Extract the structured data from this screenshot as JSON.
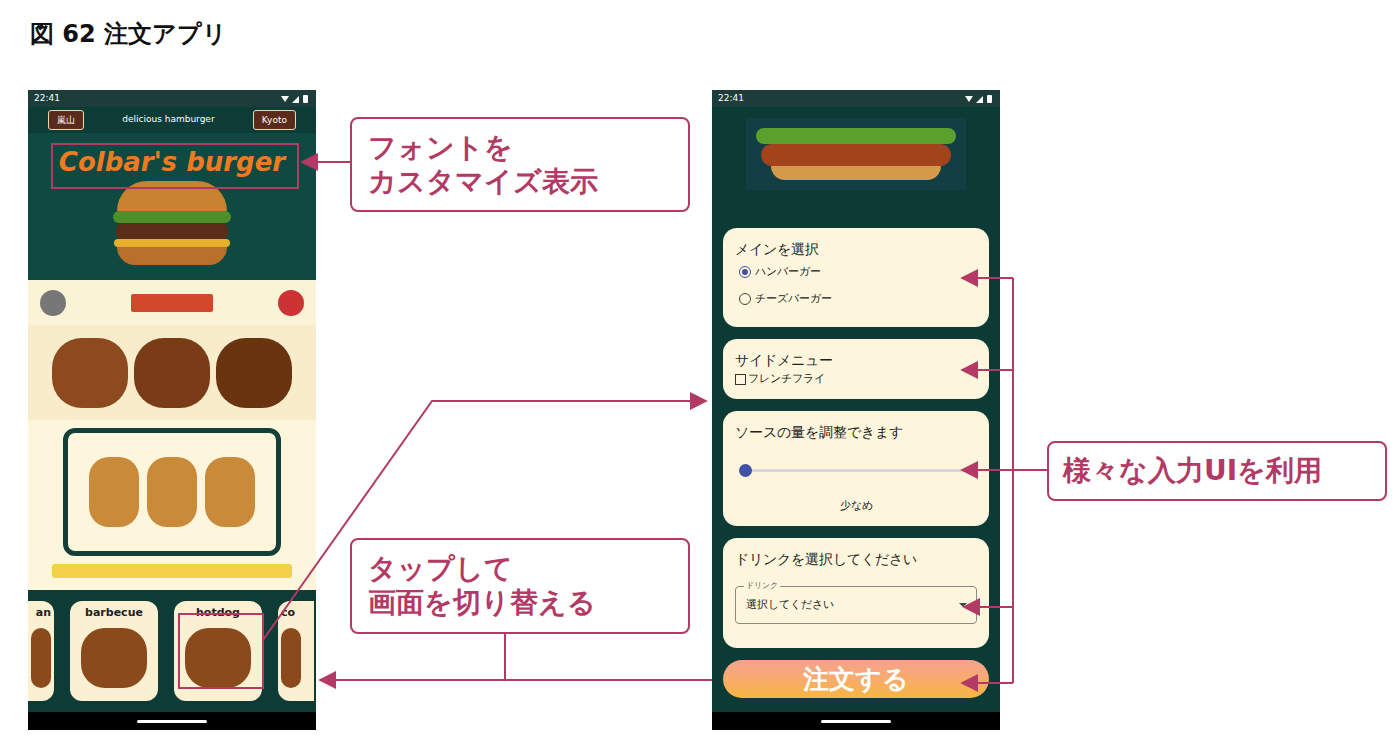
{
  "figure": {
    "title": "図 62 注文アプリ"
  },
  "left_phone": {
    "status_time": "22:41",
    "top_bar": {
      "left_button": "嵐山",
      "title": "delicious hamburger",
      "right_button": "Kyoto"
    },
    "logo": "Colbar's burger",
    "menu": [
      {
        "label": "an"
      },
      {
        "label": "barbecue"
      },
      {
        "label": "hotdog"
      },
      {
        "label": "co"
      }
    ]
  },
  "right_phone": {
    "status_time": "22:41",
    "main": {
      "title": "メインを選択",
      "options": [
        {
          "label": "ハンバーガー",
          "selected": true
        },
        {
          "label": "チーズバーガー",
          "selected": false
        }
      ]
    },
    "side": {
      "title": "サイドメニュー",
      "options": [
        {
          "label": "フレンチフライ",
          "checked": false
        }
      ]
    },
    "sauce": {
      "title": "ソースの量を調整できます",
      "level": 0,
      "reading": "少なめ"
    },
    "drink": {
      "title": "ドリンクを選択してください",
      "label": "ドリンク",
      "value": "選択してください"
    },
    "order_button": "注文する"
  },
  "callouts": [
    {
      "lines": [
        "フォントを",
        "カスタマイズ表示"
      ]
    },
    {
      "lines": [
        "タップして",
        "画面を切り替える"
      ]
    },
    {
      "lines": [
        "様々な入力UIを利用"
      ]
    }
  ]
}
